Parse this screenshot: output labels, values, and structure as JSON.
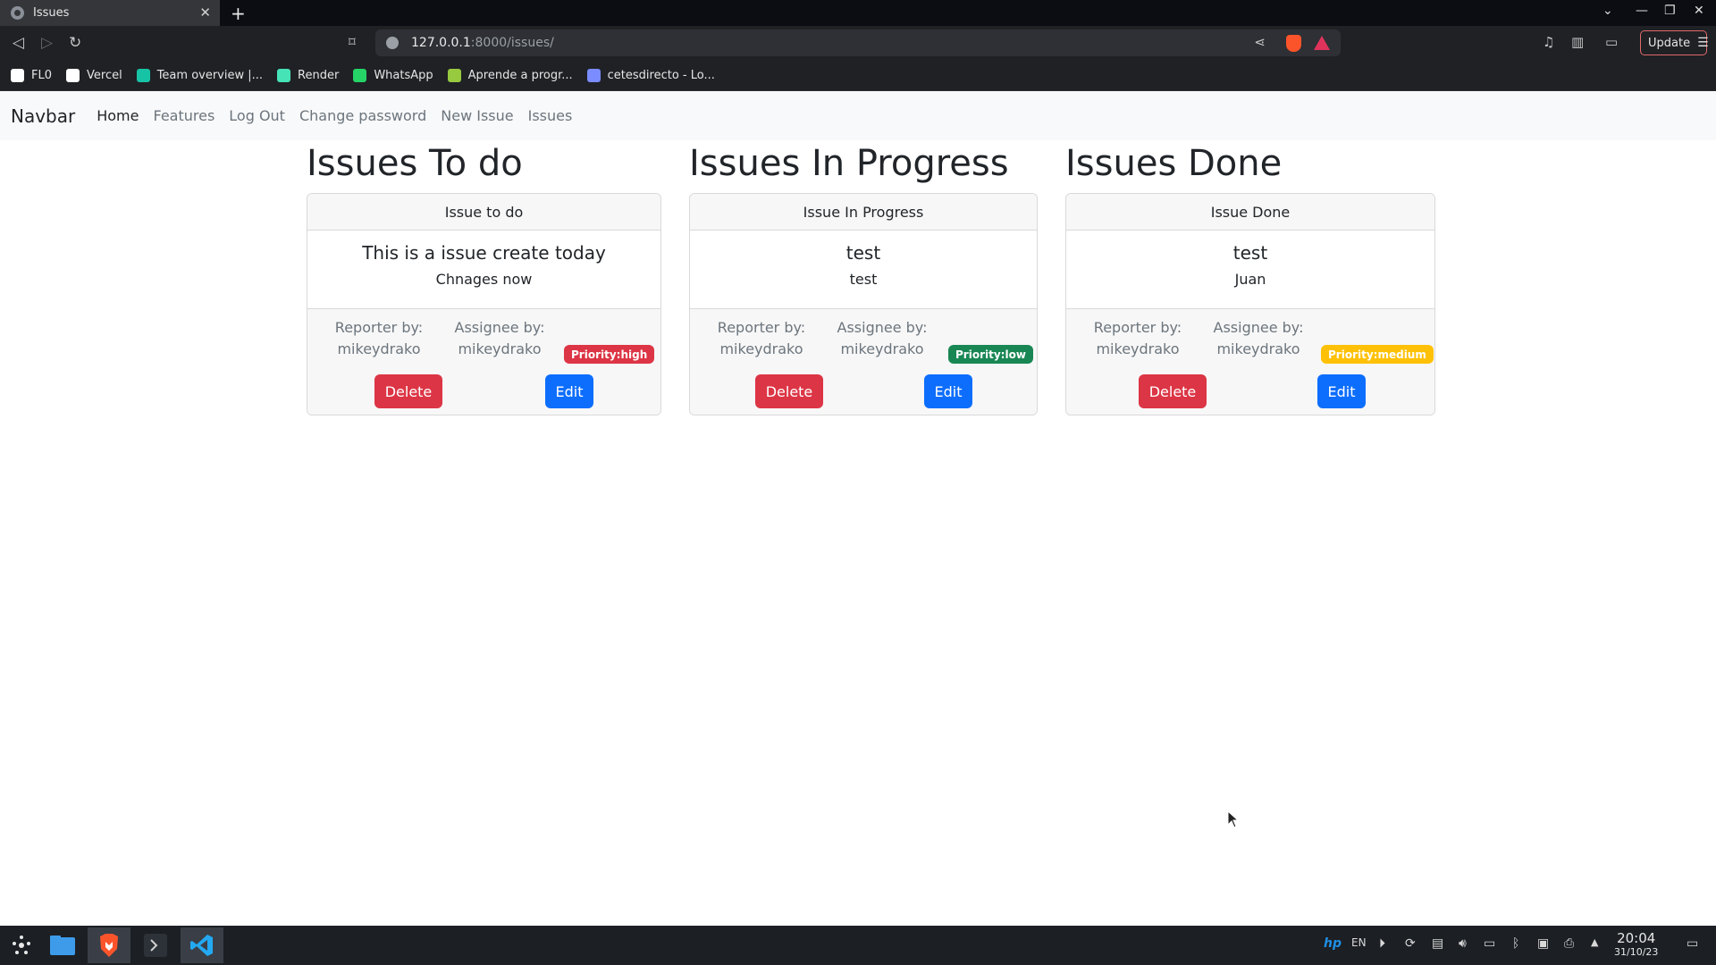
{
  "browser": {
    "tab_title": "Issues",
    "url_host": "127.0.0.1",
    "url_path": ":8000/issues/",
    "update_label": "Update",
    "bookmarks": [
      {
        "label": "FL0",
        "icon": "fl0-icon",
        "color": "#ffffff"
      },
      {
        "label": "Vercel",
        "icon": "vercel-icon",
        "color": "#ffffff"
      },
      {
        "label": "Team overview |...",
        "icon": "diamond-icon",
        "color": "#17c3a5"
      },
      {
        "label": "Render",
        "icon": "render-icon",
        "color": "#46e3b7"
      },
      {
        "label": "WhatsApp",
        "icon": "whatsapp-icon",
        "color": "#25d366"
      },
      {
        "label": "Aprende a progr...",
        "icon": "platzi-icon",
        "color": "#98ca3f"
      },
      {
        "label": "cetesdirecto - Lo...",
        "icon": "cetes-icon",
        "color": "#7a8cff"
      }
    ]
  },
  "navbar": {
    "brand": "Navbar",
    "links": [
      {
        "label": "Home",
        "active": true
      },
      {
        "label": "Features",
        "active": false
      },
      {
        "label": "Log Out",
        "active": false
      },
      {
        "label": "Change password",
        "active": false
      },
      {
        "label": "New Issue",
        "active": false
      },
      {
        "label": "Issues",
        "active": false
      }
    ]
  },
  "columns": [
    {
      "title": "Issues To do",
      "card": {
        "header": "Issue to do",
        "title": "This is a issue create today",
        "text": "Chnages now",
        "reporter_label": "Reporter by:",
        "reporter": "mikeydrako",
        "assignee_label": "Assignee by:",
        "assignee": "mikeydrako",
        "priority": "Priority:high",
        "priority_color": "#dc3545",
        "delete_label": "Delete",
        "edit_label": "Edit"
      }
    },
    {
      "title": "Issues In Progress",
      "card": {
        "header": "Issue In Progress",
        "title": "test",
        "text": "test",
        "reporter_label": "Reporter by:",
        "reporter": "mikeydrako",
        "assignee_label": "Assignee by:",
        "assignee": "mikeydrako",
        "priority": "Priority:low",
        "priority_color": "#198754",
        "delete_label": "Delete",
        "edit_label": "Edit"
      }
    },
    {
      "title": "Issues Done",
      "card": {
        "header": "Issue Done",
        "title": "test",
        "text": "Juan",
        "reporter_label": "Reporter by:",
        "reporter": "mikeydrako",
        "assignee_label": "Assignee by:",
        "assignee": "mikeydrako",
        "priority": "Priority:medium",
        "priority_color": "#ffc107",
        "delete_label": "Delete",
        "edit_label": "Edit"
      }
    }
  ],
  "taskbar": {
    "language": "EN",
    "time": "20:04",
    "date": "31/10/23"
  }
}
